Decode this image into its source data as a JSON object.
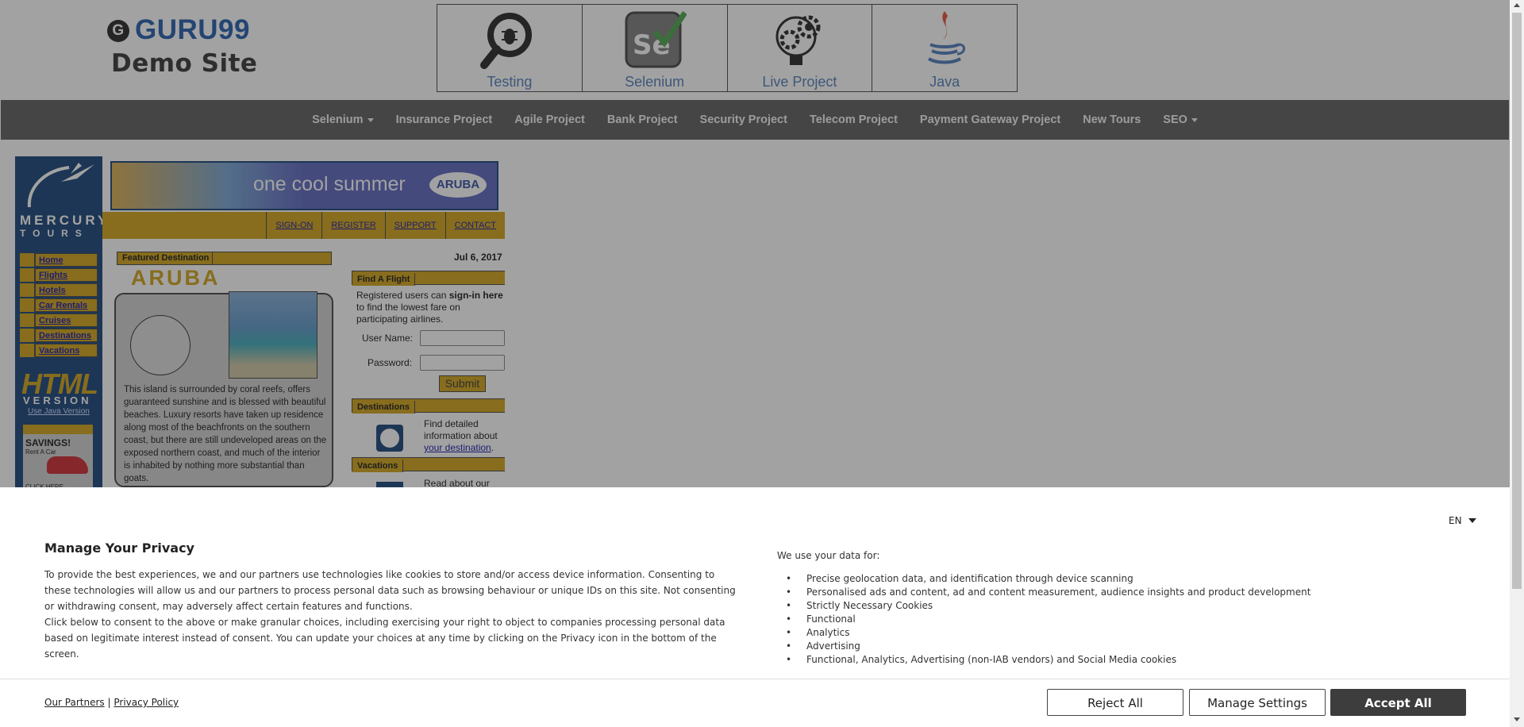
{
  "header": {
    "brand": "GURU99",
    "subtitle": "Demo Site",
    "tiles": [
      {
        "label": "Testing",
        "icon": "bug-magnifier-icon"
      },
      {
        "label": "Selenium",
        "icon": "selenium-icon"
      },
      {
        "label": "Live Project",
        "icon": "gear-bulb-icon"
      },
      {
        "label": "Java",
        "icon": "java-icon"
      }
    ]
  },
  "nav": {
    "items": [
      "Selenium",
      "Insurance Project",
      "Agile Project",
      "Bank Project",
      "Security Project",
      "Telecom Project",
      "Payment Gateway Project",
      "New Tours",
      "SEO"
    ]
  },
  "mercury": {
    "logo_top": "MERCURY",
    "logo_bottom": "TOURS",
    "banner_text": "one cool summer",
    "banner_logo": "ARUBA",
    "tabs": [
      "SIGN-ON",
      "REGISTER",
      "SUPPORT",
      "CONTACT"
    ],
    "menu": [
      "Home",
      "Flights",
      "Hotels",
      "Car Rentals",
      "Cruises",
      "Destinations",
      "Vacations"
    ],
    "html_big": "HTML",
    "html_version": "VERSION",
    "java_link": "Use Java Version",
    "ad_title": "SAVINGS!",
    "ad_sub": "Rent A Car",
    "ad_click": "CLICK HERE",
    "featured_header": "Featured Destination",
    "featured_name": "ARUBA",
    "featured_text": "This island is surrounded by coral reefs, offers guaranteed sunshine and is blessed with beautiful beaches. Luxury resorts have taken up residence along most of the beachfronts on the southern coast, but there are still undeveloped areas on the exposed northern coast, and much of the interior is inhabited by nothing more substantial than goats.",
    "date": "Jul 6, 2017",
    "find_flight": "Find A Flight",
    "ff_text_1": "Registered users can ",
    "ff_text_bold": "sign-in here",
    "ff_text_2": " to find the lowest fare on participating airlines.",
    "username_label": "User Name:",
    "password_label": "Password:",
    "submit": "Submit",
    "destinations": "Destinations",
    "dest_text": "Find detailed information about ",
    "dest_link": "your destination",
    "dest_period": ".",
    "vacations": "Vacations",
    "vac_text": "Read about our"
  },
  "privacy": {
    "lang": "EN",
    "title": "Manage Your Privacy",
    "p1": "To provide the best experiences, we and our partners use technologies like cookies to store and/or access device information. Consenting to these technologies will allow us and our partners to process personal data such as browsing behaviour or unique IDs on this site. Not consenting or withdrawing consent, may adversely affect certain features and functions.",
    "p2": "Click below to consent to the above or make granular choices, including exercising your right to object to companies processing personal data based on legitimate interest instead of consent. You can update your choices at any time by clicking on the Privacy icon in the bottom of the screen.",
    "use_data": "We use your data for:",
    "purposes": [
      "Precise geolocation data, and identification through device scanning",
      "Personalised ads and content, ad and content measurement, audience insights and product development",
      "Strictly Necessary Cookies",
      "Functional",
      "Analytics",
      "Advertising",
      "Functional, Analytics, Advertising (non-IAB vendors) and Social Media cookies"
    ],
    "partners_link": "Our Partners",
    "separator": "|",
    "policy_link": "Privacy Policy",
    "reject": "Reject All",
    "manage": "Manage Settings",
    "accept": "Accept All"
  }
}
